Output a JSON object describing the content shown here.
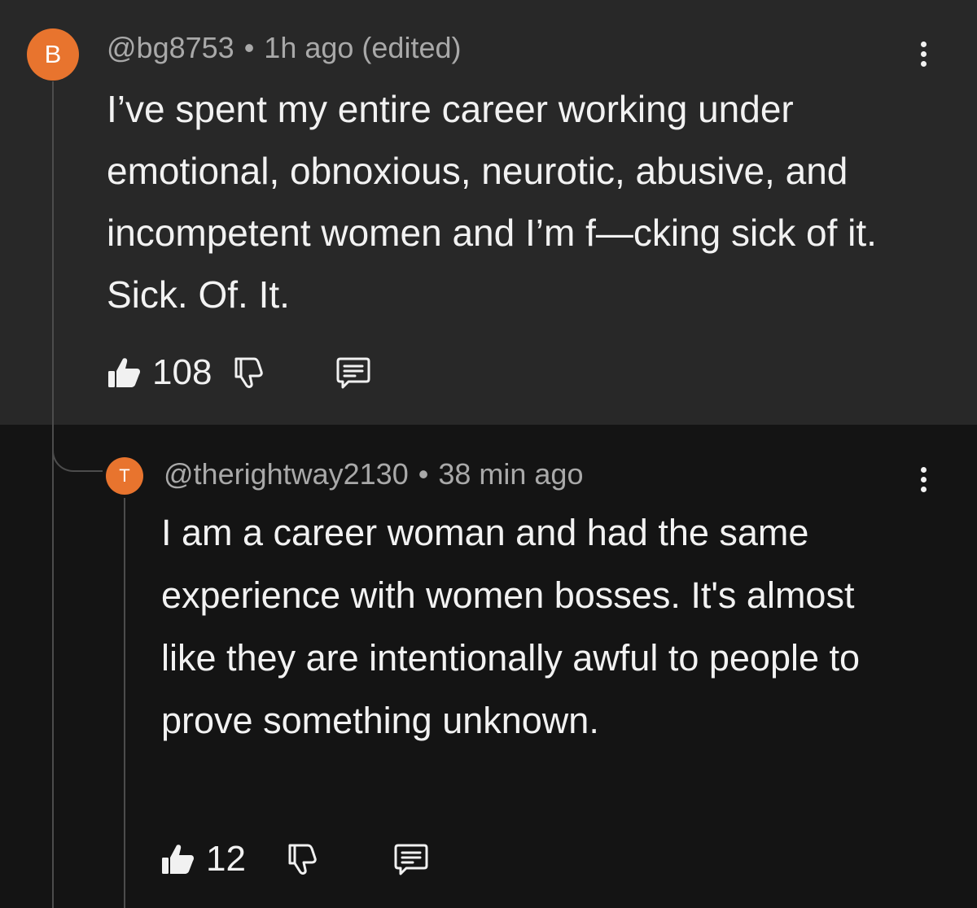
{
  "comments": [
    {
      "avatar_letter": "B",
      "username": "@bg8753",
      "separator": "•",
      "timestamp": "1h ago (edited)",
      "body": "I’ve spent my entire career working under emotional, obnoxious, neurotic, abusive, and incompetent women and I’m f—cking sick of it. Sick. Of. It.",
      "likes": "108"
    },
    {
      "avatar_letter": "T",
      "username": "@therightway2130",
      "separator": "•",
      "timestamp": "38 min ago",
      "body": "I am a career woman and had the same experience with women bosses. It's almost like they are intentionally awful to people to prove something unknown.",
      "likes": "12"
    }
  ],
  "colors": {
    "parent_bg": "#282828",
    "reply_bg": "#141414",
    "avatar": "#e8742e",
    "meta_text": "#a9a9a9",
    "body_text": "#f2f2f2"
  },
  "icons": [
    "thumbs-up-icon",
    "thumbs-down-icon",
    "reply-comment-icon",
    "more-vertical-icon"
  ]
}
